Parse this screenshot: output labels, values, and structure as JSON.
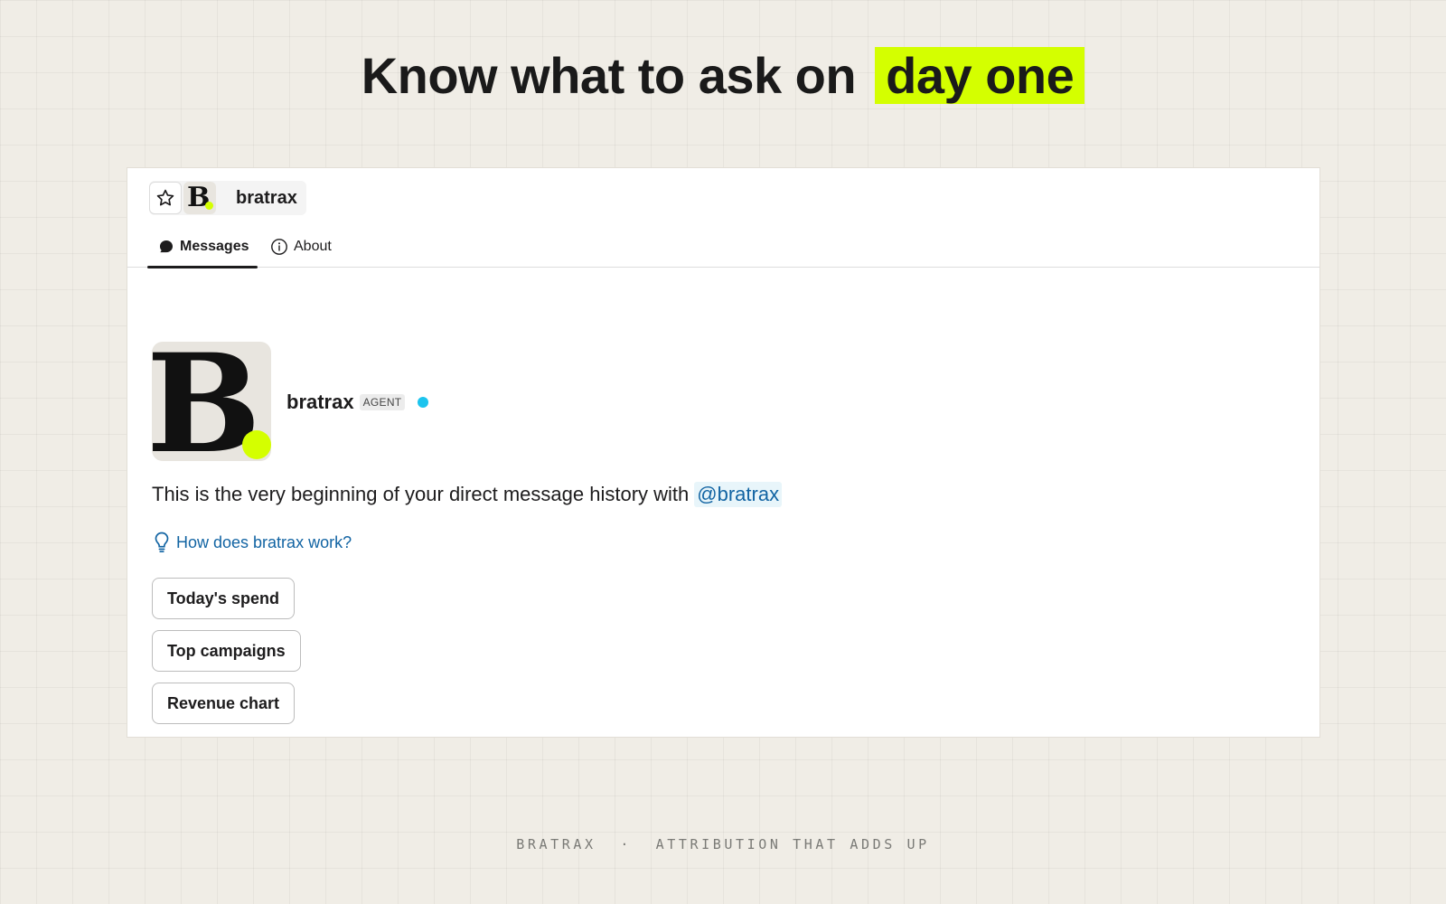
{
  "headline": {
    "text": "Know what to ask on",
    "highlight": "day one",
    "highlight_color": "#d4ff00"
  },
  "channel": {
    "name": "bratrax",
    "logo_letter": "B",
    "star_icon": "star-outline-icon"
  },
  "tabs": [
    {
      "label": "Messages",
      "icon": "chat-bubble-icon",
      "active": true
    },
    {
      "label": "About",
      "icon": "info-circle-icon",
      "active": false
    }
  ],
  "profile": {
    "name": "bratrax",
    "badge": "AGENT",
    "logo_letter": "B",
    "status_color": "#1cc4ee",
    "accent_color": "#d4ff00"
  },
  "intro": {
    "text": "This is the very beginning of your direct message history with",
    "mention": "@bratrax"
  },
  "help_link": {
    "icon": "lightbulb-icon",
    "label": "How does bratrax work?"
  },
  "suggestions": [
    "Today's spend",
    "Top campaigns",
    "Revenue chart"
  ],
  "footer": {
    "brand": "BRATRAX",
    "separator": "·",
    "tagline": "ATTRIBUTION THAT ADDS UP"
  }
}
